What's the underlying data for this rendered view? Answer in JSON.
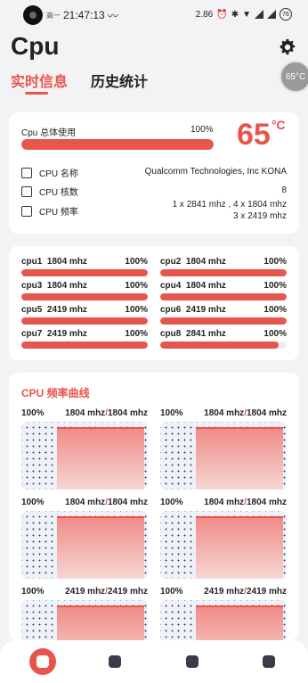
{
  "status": {
    "time": "21:47:13",
    "small_left": "高一",
    "speed": "2.86",
    "battery": "76"
  },
  "app": {
    "title": "Cpu",
    "temp_bubble": "65°C"
  },
  "tabs": [
    {
      "label": "实时信息"
    },
    {
      "label": "历史统计"
    }
  ],
  "summary": {
    "usage_label": "Cpu 总体使用",
    "usage_pct": "100%",
    "usage_fraction": 1.0,
    "temp_value": "65",
    "temp_unit": "°C",
    "rows": [
      {
        "label": "CPU 名称",
        "value": "Qualcomm Technologies, Inc KONA"
      },
      {
        "label": "CPU 核数",
        "value": "8"
      },
      {
        "label": "CPU 频率",
        "value": "1 x 2841 mhz , 4 x 1804 mhz\n3 x 2419 mhz"
      }
    ]
  },
  "cores": [
    {
      "name": "cpu1",
      "freq": "1804 mhz",
      "pct": "100%",
      "fraction": 1.0
    },
    {
      "name": "cpu2",
      "freq": "1804 mhz",
      "pct": "100%",
      "fraction": 1.0
    },
    {
      "name": "cpu3",
      "freq": "1804 mhz",
      "pct": "100%",
      "fraction": 1.0
    },
    {
      "name": "cpu4",
      "freq": "1804 mhz",
      "pct": "100%",
      "fraction": 1.0
    },
    {
      "name": "cpu5",
      "freq": "2419 mhz",
      "pct": "100%",
      "fraction": 1.0
    },
    {
      "name": "cpu6",
      "freq": "2419 mhz",
      "pct": "100%",
      "fraction": 1.0
    },
    {
      "name": "cpu7",
      "freq": "2419 mhz",
      "pct": "100%",
      "fraction": 1.0
    },
    {
      "name": "cpu8",
      "freq": "2841 mhz",
      "pct": "100%",
      "fraction": 0.94
    }
  ],
  "freq_card": {
    "title": "CPU 频率曲线",
    "charts": [
      {
        "pct": "100%",
        "cur": "1804 mhz",
        "max": "1804 mhz"
      },
      {
        "pct": "100%",
        "cur": "1804 mhz",
        "max": "1804 mhz"
      },
      {
        "pct": "100%",
        "cur": "1804 mhz",
        "max": "1804 mhz"
      },
      {
        "pct": "100%",
        "cur": "1804 mhz",
        "max": "1804 mhz"
      },
      {
        "pct": "100%",
        "cur": "2419 mhz",
        "max": "2419 mhz"
      },
      {
        "pct": "100%",
        "cur": "2419 mhz",
        "max": "2419 mhz"
      }
    ]
  },
  "colors": {
    "accent": "#e8554d",
    "bg": "#f3f3f6",
    "card": "#ffffff"
  },
  "nav": [
    {
      "icon": "cpu-icon"
    },
    {
      "icon": "ghost-icon"
    },
    {
      "icon": "storage-icon"
    },
    {
      "icon": "ghost-outline-icon"
    }
  ]
}
